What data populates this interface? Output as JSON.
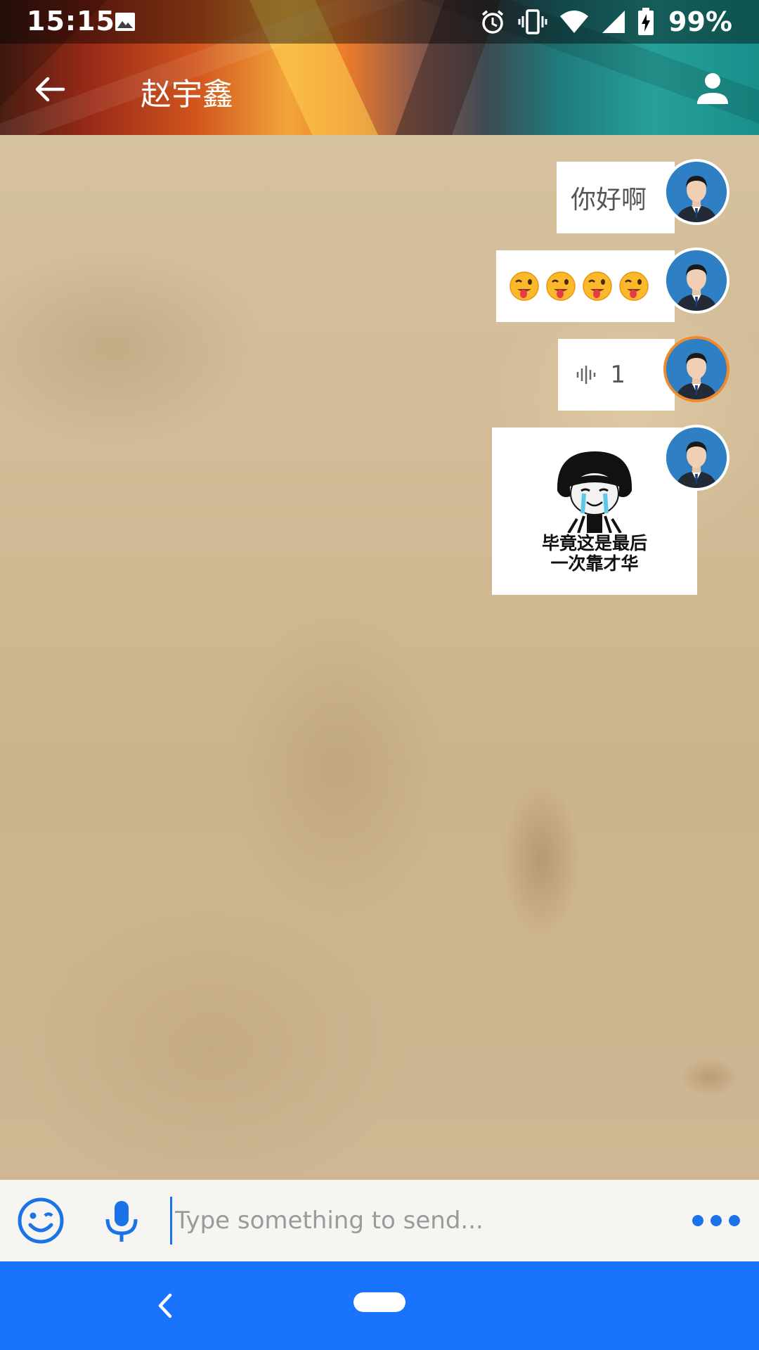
{
  "status_bar": {
    "time": "15:15",
    "battery_percent": "99%",
    "icons": [
      "image-icon",
      "alarm-icon",
      "vibrate-icon",
      "wifi-icon",
      "signal-icon",
      "battery-charging-icon"
    ]
  },
  "app_bar": {
    "title": "赵宇鑫",
    "back_icon": "arrow-back-icon",
    "profile_icon": "person-icon",
    "background": "polygon-art"
  },
  "messages": [
    {
      "type": "text",
      "text": "你好啊",
      "sender": "self"
    },
    {
      "type": "emoji",
      "emojis": [
        "winking-face-tongue",
        "winking-face-tongue",
        "winking-face-tongue",
        "winking-face-tongue"
      ],
      "sender": "self"
    },
    {
      "type": "voice",
      "duration": "1",
      "sender": "self"
    },
    {
      "type": "sticker",
      "caption_line1": "毕竟这是最后",
      "caption_line2": "一次靠才华",
      "sender": "self"
    }
  ],
  "input_bar": {
    "placeholder": "Type something to send...",
    "value": "",
    "emoji_icon": "smiley-icon",
    "mic_icon": "microphone-icon",
    "more_icon": "more-dots-icon"
  },
  "nav_bar": {
    "color": "#1a73fc"
  },
  "colors": {
    "accent": "#1a73e8",
    "avatar_bg": "#2f7fc4",
    "voice_avatar_ring": "#f08a2a"
  }
}
